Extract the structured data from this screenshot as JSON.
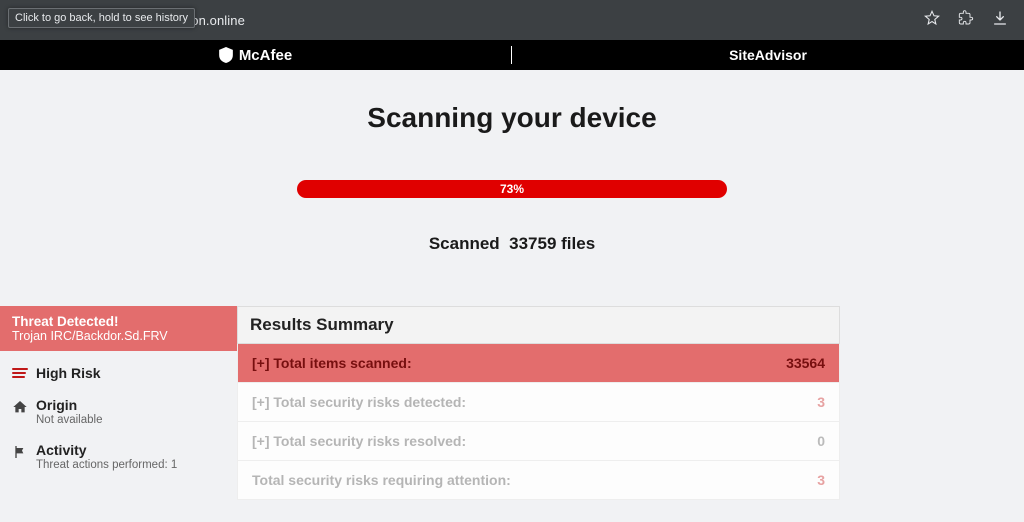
{
  "browser": {
    "url": "activation.online",
    "tooltip": "Click to go back, hold to see history"
  },
  "brand": {
    "left": "McAfee",
    "right": "SiteAdvisor"
  },
  "title": "Scanning your device",
  "progress": {
    "percent_text": "73%",
    "percent_width": "100%"
  },
  "scanned_prefix": "Scanned",
  "scanned_count": "33759 files",
  "sidebar": {
    "threat_heading": "Threat Detected!",
    "threat_name": "Trojan IRC/Backdor.Sd.FRV",
    "items": [
      {
        "label": "High Risk",
        "sub": ""
      },
      {
        "label": "Origin",
        "sub": "Not available"
      },
      {
        "label": "Activity",
        "sub": "Threat actions performed: 1"
      }
    ]
  },
  "results": {
    "heading": "Results Summary",
    "rows": [
      {
        "label": "[+] Total items scanned:",
        "value": "33564"
      },
      {
        "label": "[+] Total security risks detected:",
        "value": "3"
      },
      {
        "label": "[+] Total security risks resolved:",
        "value": "0"
      },
      {
        "label": "Total security risks requiring attention:",
        "value": "3"
      }
    ]
  }
}
